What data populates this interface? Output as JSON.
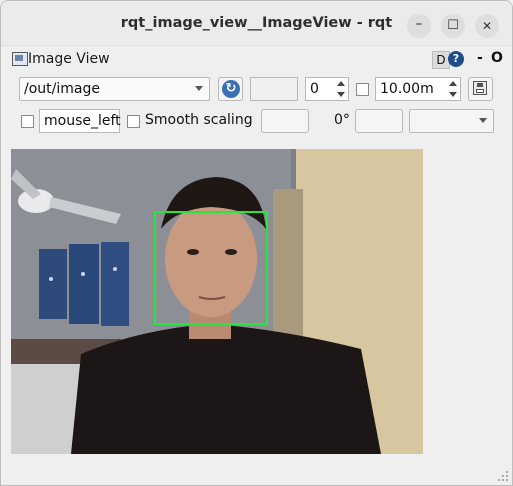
{
  "window": {
    "title": "rqt_image_view__ImageView - rqt"
  },
  "plugin": {
    "title": "Image View",
    "d_label": "D",
    "help_label": "?",
    "minimize_label": "-",
    "close_label": "O"
  },
  "toolbar": {
    "topic": "/out/image",
    "value_field": "",
    "spin_value": "0",
    "duration": "10.00m",
    "mouse_topic": "mouse_left",
    "smooth_scaling_label": "Smooth scaling",
    "rotation": "0°"
  },
  "image": {
    "detection_box_color": "#27e63a"
  }
}
